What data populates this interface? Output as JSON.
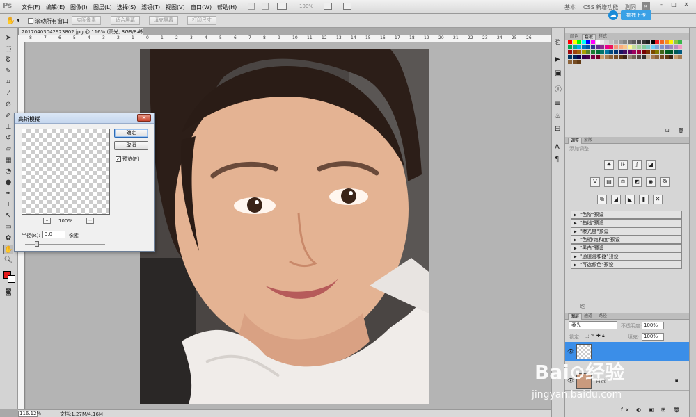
{
  "app": {
    "logo": "Ps"
  },
  "menu": [
    "文件(F)",
    "编辑(E)",
    "图像(I)",
    "图层(L)",
    "选择(S)",
    "滤镜(T)",
    "视图(V)",
    "窗口(W)",
    "帮助(H)"
  ],
  "appbar": {
    "zoom": "100%"
  },
  "workspaces": [
    "基本",
    "CSS 新增功能",
    "副同"
  ],
  "window_controls": [
    "–",
    "□",
    "✕"
  ],
  "upload": {
    "button": "拖拽上传"
  },
  "options": {
    "scroll_all_label": "滚动所有窗口",
    "buttons": [
      "实际像素",
      "适合屏幕",
      "填充屏幕",
      "打印尺寸"
    ]
  },
  "document": {
    "tab_title": "20170403042923802.jpg @ 116% (高光, RGB/8#) *",
    "ruler_ticks": [
      "8",
      "7",
      "6",
      "5",
      "4",
      "3",
      "2",
      "1",
      "0",
      "1",
      "2",
      "3",
      "4",
      "5",
      "6",
      "7",
      "8",
      "9",
      "10",
      "11",
      "12",
      "13",
      "14",
      "15",
      "16",
      "17",
      "18",
      "19",
      "20",
      "21",
      "22",
      "23",
      "24",
      "25",
      "26"
    ]
  },
  "status": {
    "zoom": "116.12%",
    "doc_size": "文档:1.27M/4.16M"
  },
  "dialog": {
    "title": "高斯模糊",
    "close": "✕",
    "ok": "确定",
    "cancel": "取消",
    "preview_label": "预览(P)",
    "preview_checked": "✓",
    "zoom_minus": "–",
    "zoom_plus": "+",
    "zoom_pct": "100%",
    "radius_label": "半径(R):",
    "radius_value": "3.0",
    "radius_unit": "像素"
  },
  "panels": {
    "swatches_tabs": [
      "颜色",
      "色板",
      "样式"
    ],
    "adjust_tabs": [
      "调整",
      "蒙版"
    ],
    "adjust_label": "添加调整",
    "presets": [
      "\"色阶\"预设",
      "\"曲线\"预设",
      "\"曝光度\"预设",
      "\"色相/饱和度\"预设",
      "\"黑白\"预设",
      "\"通道混和器\"预设",
      "\"可选颜色\"预设"
    ],
    "layers_tabs": [
      "图层",
      "通道",
      "路径"
    ],
    "blend_mode": "柔光",
    "opacity_label": "不透明度:",
    "opacity": "100%",
    "lock_label": "锁定:",
    "fill_label": "填充:",
    "fill": "100%",
    "layer_bg_name": "背景"
  },
  "watermark": {
    "logo": "Bai⊙经验",
    "url": "jingyan.baidu.com"
  },
  "colors": {
    "fg": "#e41b1b",
    "bg": "#ffffff",
    "selected_layer": "#3b8ee8"
  }
}
